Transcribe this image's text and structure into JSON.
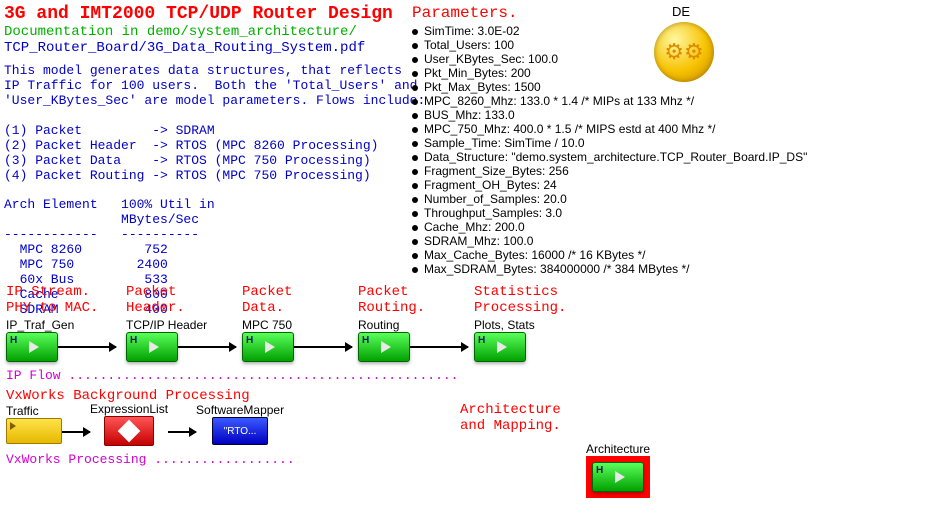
{
  "title": "3G and IMT2000 TCP/UDP Router Design",
  "doc_line1": "Documentation in demo/system_architecture/",
  "doc_line2": "TCP_Router_Board/3G_Data_Routing_System.pdf",
  "description": "This model generates data structures, that reflects\nIP Traffic for 100 users.  Both the 'Total_Users' and\n'User_KBytes_Sec' are model parameters. Flows include:\n\n(1) Packet         -> SDRAM\n(2) Packet Header  -> RTOS (MPC 8260 Processing)\n(3) Packet Data    -> RTOS (MPC 750 Processing)\n(4) Packet Routing -> RTOS (MPC 750 Processing)\n\nArch Element   100% Util in\n               MBytes/Sec\n------------   ----------\n  MPC 8260        752\n  MPC 750        2400\n  60x Bus         533\n  Cache           800\n  SDRAM           400",
  "director": "DE",
  "params_header": "Parameters.",
  "params": [
    "SimTime: 3.0E-02",
    "Total_Users: 100",
    "User_KBytes_Sec: 100.0",
    "Pkt_Min_Bytes: 200",
    "Pkt_Max_Bytes: 1500",
    "MPC_8260_Mhz: 133.0 * 1.4 /* MIPs at 133 Mhz */",
    "BUS_Mhz: 133.0",
    "MPC_750_Mhz: 400.0 * 1.5 /* MIPS estd at 400 Mhz */",
    "Sample_Time: SimTime / 10.0",
    "Data_Structure: \"demo.system_architecture.TCP_Router_Board.IP_DS\"",
    "Fragment_Size_Bytes: 256",
    "Fragment_OH_Bytes: 24",
    "Number_of_Samples: 20.0",
    "Throughput_Samples: 3.0",
    "Cache_Mhz: 200.0",
    "SDRAM_Mhz: 100.0",
    "Max_Cache_Bytes: 16000  /* 16 KBytes */",
    "Max_SDRAM_Bytes: 384000000  /* 384 MBytes */"
  ],
  "stages": [
    {
      "red": "IP Stream.\nPHY to MAC.",
      "black": "IP_Traf_Gen"
    },
    {
      "red": "Packet\nHeader.",
      "black": "TCP/IP Header"
    },
    {
      "red": "Packet\nData.",
      "black": "MPC 750"
    },
    {
      "red": "Packet\nRouting.",
      "black": "Routing"
    },
    {
      "red": "Statistics\nProcessing.",
      "black": "Plots, Stats"
    }
  ],
  "ip_flow_label": "IP Flow ..................................................",
  "vx_heading": "VxWorks Background Processing",
  "vx_blocks": {
    "traffic": "Traffic",
    "expr": "ExpressionList",
    "mapper": "SoftwareMapper",
    "rto": "\"RTO..."
  },
  "vx_flow_label": "VxWorks Processing ..................",
  "arch_label": "Architecture\nand Mapping.",
  "arch_block": "Architecture"
}
